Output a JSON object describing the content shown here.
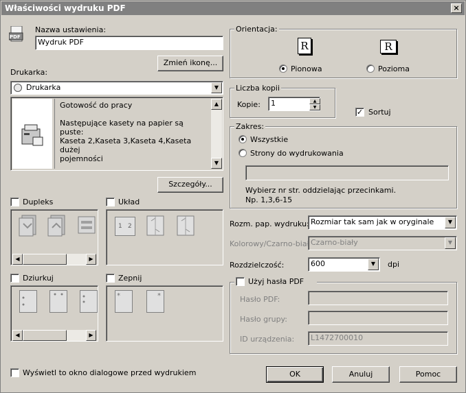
{
  "window": {
    "title": "Właściwości wydruku PDF",
    "close": "×"
  },
  "name_section": {
    "label": "Nazwa ustawienia:",
    "value": "Wydruk PDF",
    "change_icon_button": "Zmień ikonę..."
  },
  "printer": {
    "label": "Drukarka:",
    "selected": "Drukarka",
    "status_title": "Gotowość do pracy",
    "status_lines": [
      "Następujące kasety na papier są puste:",
      "Kaseta 2,Kaseta 3,Kaseta 4,Kaseta dużej",
      "pojemności"
    ],
    "details_button": "Szczegóły..."
  },
  "duplex": {
    "label": "Dupleks",
    "checked": false
  },
  "layout": {
    "label": "Układ",
    "checked": false,
    "page_marks": [
      "1",
      "2"
    ]
  },
  "punch": {
    "label": "Dziurkuj",
    "checked": false
  },
  "staple": {
    "label": "Zepnij",
    "checked": false
  },
  "show_dialog": {
    "label": "Wyświetl to okno dialogowe przed wydrukiem",
    "checked": false
  },
  "orientation": {
    "legend": "Orientacja:",
    "icon_letter": "R",
    "portrait": "Pionowa",
    "landscape": "Pozioma",
    "selected": "portrait"
  },
  "copies": {
    "legend": "Liczba kopii",
    "label": "Kopie:",
    "value": "1",
    "collate_label": "Sortuj",
    "collate_checked": true
  },
  "range": {
    "legend": "Zakres:",
    "all": "Wszystkie",
    "pages": "Strony do wydrukowania",
    "pages_value": "",
    "hint1": "Wybierz nr str. oddzielając przecinkami.",
    "hint2": "Np. 1,3,6-15"
  },
  "paper_size": {
    "label": "Rozm. pap. wydruku:",
    "value": "Rozmiar tak sam jak w oryginale"
  },
  "color_mode": {
    "label": "Kolorowy/Czarno-biały:",
    "value": "Czarno-biały"
  },
  "resolution": {
    "label": "Rozdzielczość:",
    "value": "600",
    "unit": "dpi"
  },
  "password": {
    "legend": "Użyj hasła PDF",
    "checked": false,
    "pdf_password_label": "Hasło PDF:",
    "group_password_label": "Hasło grupy:",
    "device_id_label": "ID urządzenia:",
    "device_id_value": "L1472700010"
  },
  "buttons": {
    "ok": "OK",
    "cancel": "Anuluj",
    "help": "Pomoc"
  }
}
